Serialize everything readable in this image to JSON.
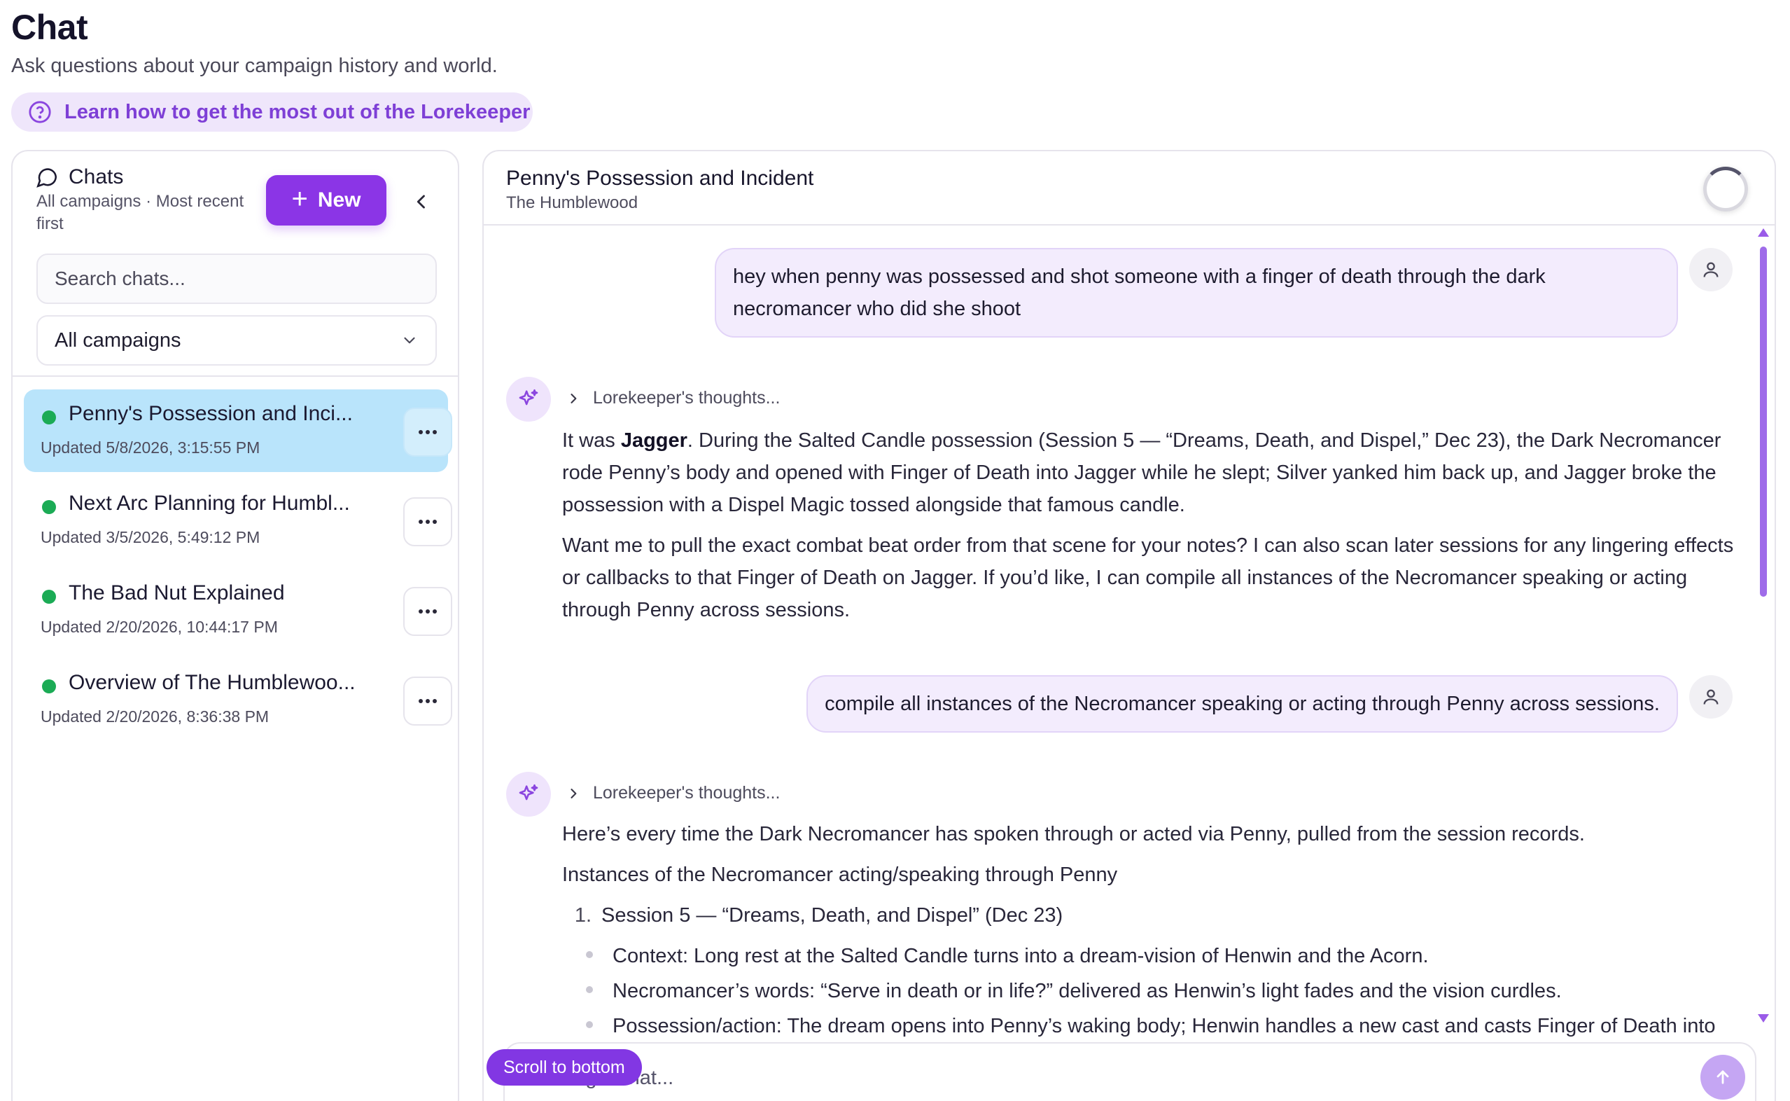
{
  "header": {
    "title": "Chat",
    "subtitle": "Ask questions about your campaign history and world.",
    "learn_link": "Learn how to get the most out of the Lorekeeper"
  },
  "sidebar": {
    "label": "Chats",
    "sublabel": "All campaigns · Most recent first",
    "new_label": "New",
    "search_placeholder": "Search chats...",
    "campaign_filter": "All campaigns",
    "items": [
      {
        "title": "Penny's Possession and Inci...",
        "updated": "Updated 5/8/2026, 3:15:55 PM",
        "active": true
      },
      {
        "title": "Next Arc Planning for Humbl...",
        "updated": "Updated 3/5/2026, 5:49:12 PM",
        "active": false
      },
      {
        "title": "The Bad Nut Explained",
        "updated": "Updated 2/20/2026, 10:44:17 PM",
        "active": false
      },
      {
        "title": "Overview of The Humblewoo...",
        "updated": "Updated 2/20/2026, 8:36:38 PM",
        "active": false
      }
    ]
  },
  "conversation": {
    "title": "Penny's Possession and Incident",
    "campaign": "The Humblewood",
    "thoughts_label": "Lorekeeper's thoughts...",
    "msg1_user": "hey when penny was possessed and shot someone with a finger of death through the dark necromancer who did she shoot",
    "msg2_pre": "It was ",
    "msg2_bold": "Jagger",
    "msg2_post": ". During the Salted Candle possession (Session 5 — “Dreams, Death, and Dispel,” Dec 23), the Dark Necromancer rode Penny’s body and opened with Finger of Death into Jagger while he slept; Silver yanked him back up, and Jagger broke the possession with a Dispel Magic tossed alongside that famous candle.",
    "msg2_para2": "Want me to pull the exact combat beat order from that scene for your notes? I can also scan later sessions for any lingering effects or callbacks to that Finger of Death on Jagger. If you’d like, I can compile all instances of the Necromancer speaking or acting through Penny across sessions.",
    "msg3_user": "compile all instances of the Necromancer speaking or acting through Penny across sessions.",
    "msg4_intro": "Here’s every time the Dark Necromancer has spoken through or acted via Penny, pulled from the session records.",
    "msg4_heading": "Instances of the Necromancer acting/speaking through Penny",
    "msg4_list_num": "1.",
    "msg4_list_item": "Session 5 — “Dreams, Death, and Dispel” (Dec 23)",
    "msg4_bullet1": "Context: Long rest at the Salted Candle turns into a dream-vision of Henwin and the Acorn.",
    "msg4_bullet2": "Necromancer’s words: “Serve in death or in life?” delivered as Henwin’s light fades and the vision curdles.",
    "msg4_bullet3": "Possession/action: The dream opens into Penny’s waking body; Henwin handles a new cast and casts Finger of Death into"
  },
  "scroll_to_bottom": "Scroll to bottom",
  "composer_placeholder": "Message Chat..."
}
